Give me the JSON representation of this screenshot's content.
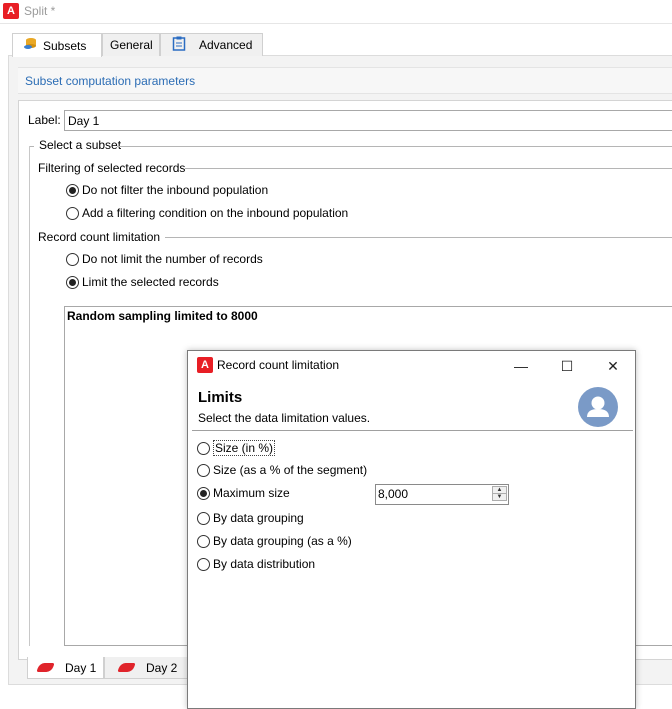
{
  "window": {
    "title": "Split *"
  },
  "tabs": [
    {
      "label": "Subsets",
      "icon": "database-icon"
    },
    {
      "label": "General"
    },
    {
      "label": "Advanced",
      "icon": "clipboard-icon"
    }
  ],
  "section": {
    "title": "Subset computation parameters"
  },
  "label_field": {
    "label": "Label:",
    "value": "Day 1"
  },
  "select_subset": {
    "legend": "Select a subset",
    "filtering": {
      "legend": "Filtering of selected records",
      "options": [
        {
          "label": "Do not filter the inbound population",
          "checked": true
        },
        {
          "label": "Add a filtering condition on the inbound population",
          "checked": false
        }
      ]
    },
    "limitation": {
      "legend": "Record count limitation",
      "options": [
        {
          "label": "Do not limit the number of records",
          "checked": false
        },
        {
          "label": "Limit the selected records",
          "checked": true
        }
      ]
    },
    "description": "Random sampling limited to 8000"
  },
  "bottom_tabs": [
    {
      "label": "Day 1"
    },
    {
      "label": "Day 2"
    }
  ],
  "dialog": {
    "title": "Record count limitation",
    "heading": "Limits",
    "subtitle": "Select the data limitation values.",
    "options": [
      {
        "label": "Size (in %)",
        "checked": false
      },
      {
        "label": "Size (as a % of the segment)",
        "checked": false
      },
      {
        "label": "Maximum size",
        "checked": true
      },
      {
        "label": "By data grouping",
        "checked": false
      },
      {
        "label": "By data grouping (as a %)",
        "checked": false
      },
      {
        "label": "By data distribution",
        "checked": false
      }
    ],
    "max_size_value": "8,000",
    "buttons": {
      "minimize": "—",
      "maximize": "☐",
      "close": "✕"
    }
  },
  "colors": {
    "brand": "#e81e25",
    "link": "#2c6db5",
    "avatar": "#7a9ac7"
  }
}
